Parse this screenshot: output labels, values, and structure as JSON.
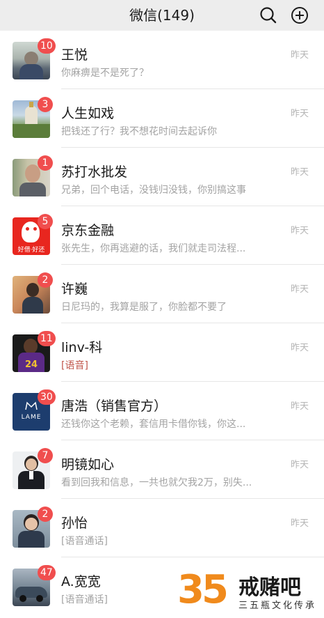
{
  "header": {
    "title": "微信(149)"
  },
  "chats": [
    {
      "name": "王悦",
      "preview": "你麻痹是不是死了？",
      "time": "昨天",
      "badge": "10",
      "preview_red": false
    },
    {
      "name": "人生如戏",
      "preview": "把钱还了行？我不想花时间去起诉你",
      "time": "昨天",
      "badge": "3",
      "preview_red": false
    },
    {
      "name": "苏打水批发",
      "preview": "兄弟，回个电话，没钱归没钱，你别搞这事",
      "time": "昨天",
      "badge": "1",
      "preview_red": false
    },
    {
      "name": "京东金融",
      "preview": "张先生，你再逃避的话，我们就走司法程...",
      "time": "昨天",
      "badge": "5",
      "preview_red": false,
      "avatar_text": "好借·好还"
    },
    {
      "name": "许巍",
      "preview": "日尼玛的，我算是服了，你脸都不要了",
      "time": "昨天",
      "badge": "2",
      "preview_red": false
    },
    {
      "name": "linv-科",
      "preview": "[语音]",
      "time": "昨天",
      "badge": "11",
      "preview_red": true,
      "avatar_text": "24"
    },
    {
      "name": "唐浩（销售官方）",
      "preview": "还钱你这个老赖，套信用卡借你钱，你这...",
      "time": "昨天",
      "badge": "30",
      "preview_red": false,
      "avatar_text": "LAME"
    },
    {
      "name": "明镜如心",
      "preview": "看到回我和信息，一共也就欠我2万，别失...",
      "time": "昨天",
      "badge": "7",
      "preview_red": false
    },
    {
      "name": "孙怡",
      "preview": "[语音通话]",
      "time": "昨天",
      "badge": "2",
      "preview_red": false
    },
    {
      "name": "A.宽宽",
      "preview": "[语音通话]",
      "time": "",
      "badge": "47",
      "preview_red": false
    }
  ],
  "watermark": {
    "number": "35",
    "title": "戒赌吧",
    "subtitle": "三五瓶文化传承"
  },
  "colors": {
    "header_bg": "#ededed",
    "badge": "#f04e4e",
    "preview": "#a3a3a3",
    "voice_red": "#c0564b"
  }
}
